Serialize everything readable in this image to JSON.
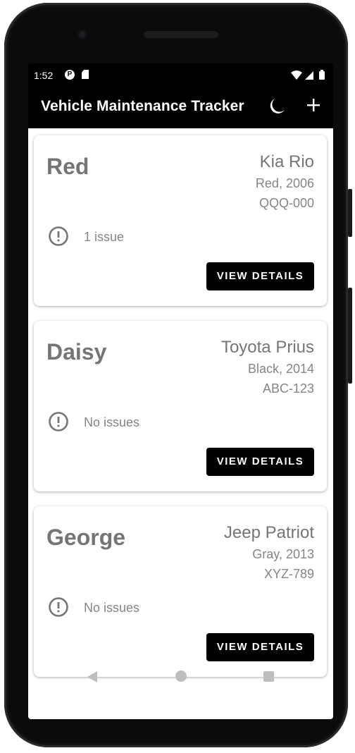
{
  "status_bar": {
    "time": "1:52"
  },
  "app_bar": {
    "title": "Vehicle Maintenance Tracker"
  },
  "vehicles": [
    {
      "name": "Red",
      "model": "Kia Rio",
      "colour_year": "Red, 2006",
      "plate": "QQQ-000",
      "issues": "1 issue",
      "button": "VIEW DETAILS"
    },
    {
      "name": "Daisy",
      "model": "Toyota Prius",
      "colour_year": "Black, 2014",
      "plate": "ABC-123",
      "issues": "No issues",
      "button": "VIEW DETAILS"
    },
    {
      "name": "George",
      "model": "Jeep Patriot",
      "colour_year": "Gray, 2013",
      "plate": "XYZ-789",
      "issues": "No issues",
      "button": "VIEW DETAILS"
    }
  ],
  "colors": {
    "app_bar": "#000000",
    "button_bg": "#000000",
    "name_text": "#757575",
    "secondary_text": "#858585"
  },
  "icons": {
    "theme_toggle": "moon-icon",
    "add": "add-icon",
    "issue": "alert-circle-icon"
  }
}
